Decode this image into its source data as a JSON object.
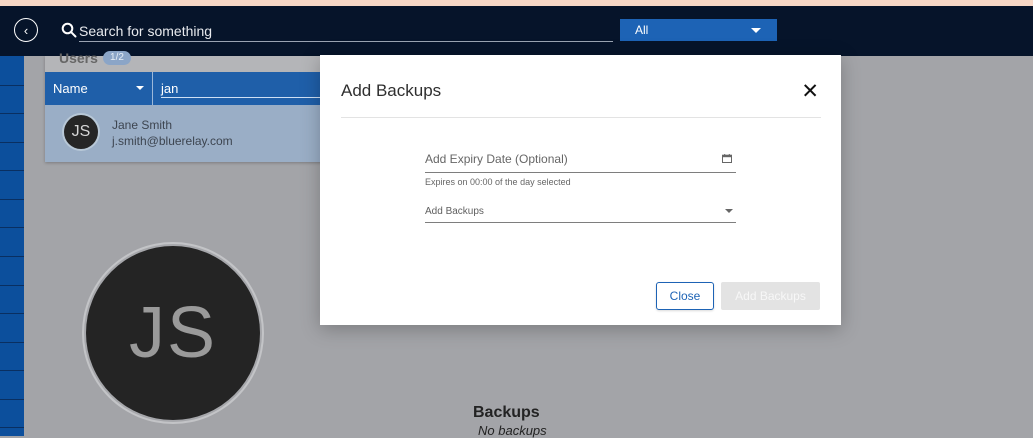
{
  "header": {
    "search": {
      "placeholder": "Search for something",
      "value": ""
    },
    "scope": {
      "selected": "All"
    }
  },
  "users_card": {
    "title": "Users",
    "count": "1/2",
    "table": {
      "column": "Name",
      "filter_value": "jan"
    },
    "rows": [
      {
        "initials": "JS",
        "name": "Jane Smith",
        "email": "j.smith@bluerelay.com"
      }
    ]
  },
  "profile": {
    "initials": "JS"
  },
  "backups_section": {
    "title": "Backups",
    "empty_text": "No backups"
  },
  "modal": {
    "title": "Add Backups",
    "expiry": {
      "placeholder": "Add Expiry Date (Optional)",
      "hint": "Expires on 00:00 of the day selected"
    },
    "backups_select": {
      "placeholder": "Add Backups"
    },
    "buttons": {
      "close_label": "Close",
      "add_label": "Add Backups"
    }
  },
  "colors": {
    "header_bg": "#06142a",
    "accent_blue": "#1d63b5",
    "table_header": "#1f5fa9",
    "page_gray": "#a3a4a8"
  },
  "icons": {
    "back": "back-arrow-icon",
    "search": "search-icon",
    "calendar": "calendar-icon",
    "close": "close-icon"
  }
}
